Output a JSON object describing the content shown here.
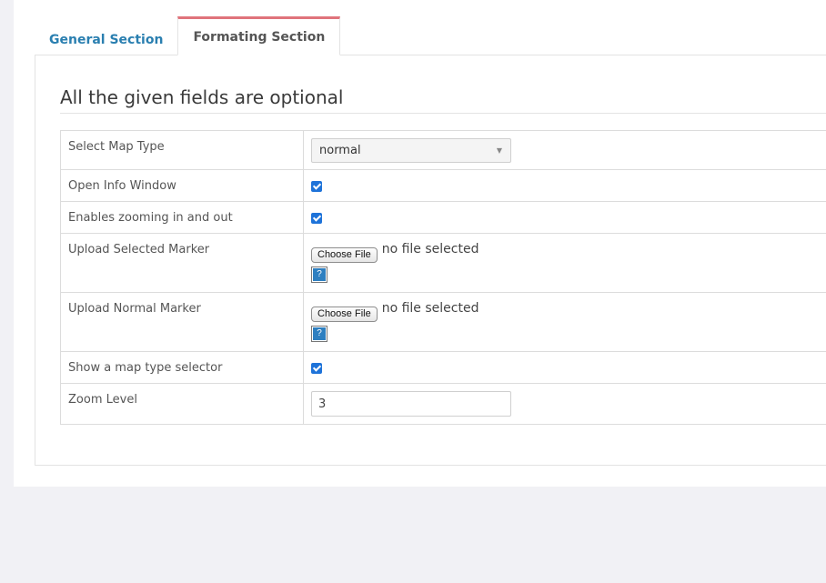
{
  "tabs": [
    {
      "label": "General Section",
      "active": false
    },
    {
      "label": "Formating Section",
      "active": true
    }
  ],
  "heading": "All the given fields are optional",
  "form": {
    "map_type": {
      "label": "Select Map Type",
      "value": "normal"
    },
    "info_window": {
      "label": "Open Info Window",
      "checked": true
    },
    "zooming": {
      "label": "Enables zooming in and out",
      "checked": true
    },
    "selected_marker": {
      "label": "Upload Selected Marker",
      "button": "Choose File",
      "status": "no file selected",
      "help": "?"
    },
    "normal_marker": {
      "label": "Upload Normal Marker",
      "button": "Choose File",
      "status": "no file selected",
      "help": "?"
    },
    "type_selector": {
      "label": "Show a map type selector",
      "checked": true
    },
    "zoom_level": {
      "label": "Zoom Level",
      "value": "3"
    }
  },
  "colors": {
    "tab_accent": "#e0737b",
    "link": "#2a7fb0",
    "checkbox": "#1e73d9",
    "background": "#f1f1f5"
  }
}
